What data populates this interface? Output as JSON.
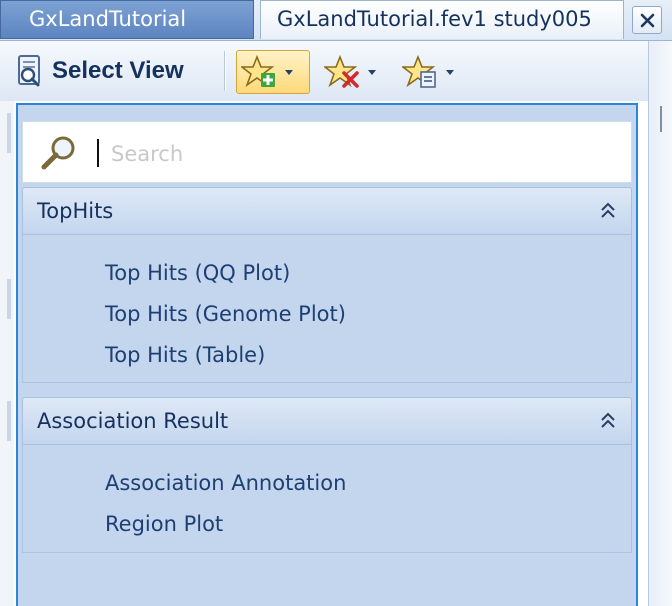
{
  "tabs": [
    {
      "label": "GxLandTutorial"
    },
    {
      "label": "GxLandTutorial.fev1 study005"
    }
  ],
  "toolbar": {
    "select_view_label": "Select View",
    "select_view_icon": "select-view-icon",
    "add_favorite_icon": "star-add-icon",
    "remove_favorite_icon": "star-remove-icon",
    "manage_favorite_icon": "star-manage-icon"
  },
  "search": {
    "placeholder": "Search",
    "value": ""
  },
  "groups": [
    {
      "title": "TopHits",
      "items": [
        "Top Hits (QQ Plot)",
        "Top Hits (Genome Plot)",
        "Top Hits (Table)"
      ]
    },
    {
      "title": "Association Result",
      "items": [
        "Association Annotation",
        "Region Plot"
      ]
    }
  ],
  "colors": {
    "accent": "#2b86d6",
    "panel_background": "#c4d6ed",
    "text": "#1d3f74",
    "active_button": "#ffd97a"
  }
}
